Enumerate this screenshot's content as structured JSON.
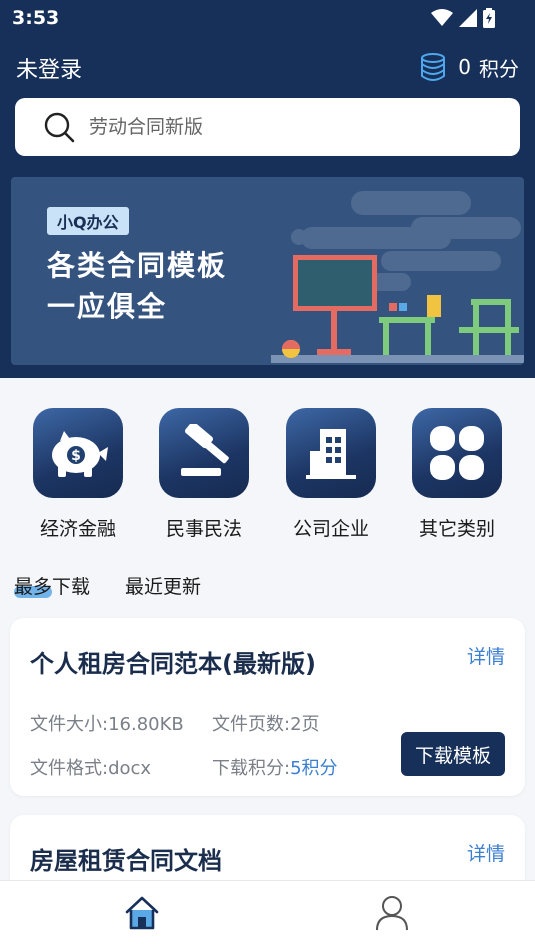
{
  "status": {
    "time": "3:53"
  },
  "header": {
    "login_text": "未登录",
    "points_value": "0",
    "points_unit": "积分"
  },
  "search": {
    "placeholder": "劳动合同新版"
  },
  "banner": {
    "tag": "小Q办公",
    "line1": "各类合同模板",
    "line2": "一应俱全"
  },
  "categories": [
    {
      "label": "经济金融",
      "icon": "piggy-bank-icon"
    },
    {
      "label": "民事民法",
      "icon": "gavel-icon"
    },
    {
      "label": "公司企业",
      "icon": "building-icon"
    },
    {
      "label": "其它类别",
      "icon": "grid-icon"
    }
  ],
  "tabs": [
    {
      "label": "最多下载",
      "active": true
    },
    {
      "label": "最近更新",
      "active": false
    }
  ],
  "cards": [
    {
      "title": "个人租房合同范本(最新版)",
      "detail": "详情",
      "size_label": "文件大小:16.80KB",
      "pages_label": "文件页数:2页",
      "format_label": "文件格式:docx",
      "points_label": "下载积分:",
      "points_value": "5积分",
      "button": "下载模板"
    },
    {
      "title": "房屋租赁合同文档",
      "detail": "详情"
    }
  ],
  "nav": [
    {
      "name": "home",
      "icon": "home-icon",
      "active": true
    },
    {
      "name": "profile",
      "icon": "user-icon",
      "active": false
    }
  ],
  "colors": {
    "header_bg": "#17305a",
    "accent": "#3c7fd1",
    "button_bg": "#17305a"
  }
}
